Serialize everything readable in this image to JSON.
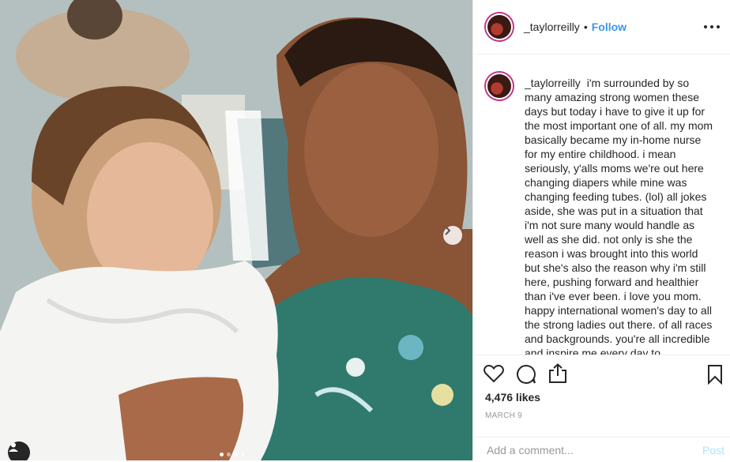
{
  "post": {
    "username": "_taylorreilly",
    "separator": "•",
    "follow_label": "Follow",
    "more_icon": "more-options-icon",
    "caption_username": "_taylorreilly",
    "caption_text": "i'm surrounded by so many amazing strong women these days but today i have to give it up for the most important one of all. my mom basically became my in-home nurse for my entire childhood. i mean seriously, y'alls moms we're out here changing diapers while mine was changing feeding tubes. (lol) all jokes aside, she was put in a situation that i'm not sure many would handle as well as she did. not only is she the reason i was brought into this world but she's also the reason why i'm still here, pushing forward and healthier than i've ever been. i love you mom. happy international women's day to all the strong ladies out there. of all races and backgrounds. you're all incredible and inspire me every day to",
    "likes": "4,476 likes",
    "date": "MARCH 9",
    "comment_placeholder": "Add a comment...",
    "post_label": "Post"
  },
  "carousel": {
    "current": 1,
    "total": 4
  },
  "colors": {
    "accent": "#3897f0",
    "post_disabled": "#b2dffc",
    "text": "#262626",
    "muted": "#999999"
  },
  "icons": [
    "heart-icon",
    "comment-icon",
    "share-icon",
    "bookmark-icon",
    "chevron-right-icon",
    "user-tag-icon"
  ]
}
